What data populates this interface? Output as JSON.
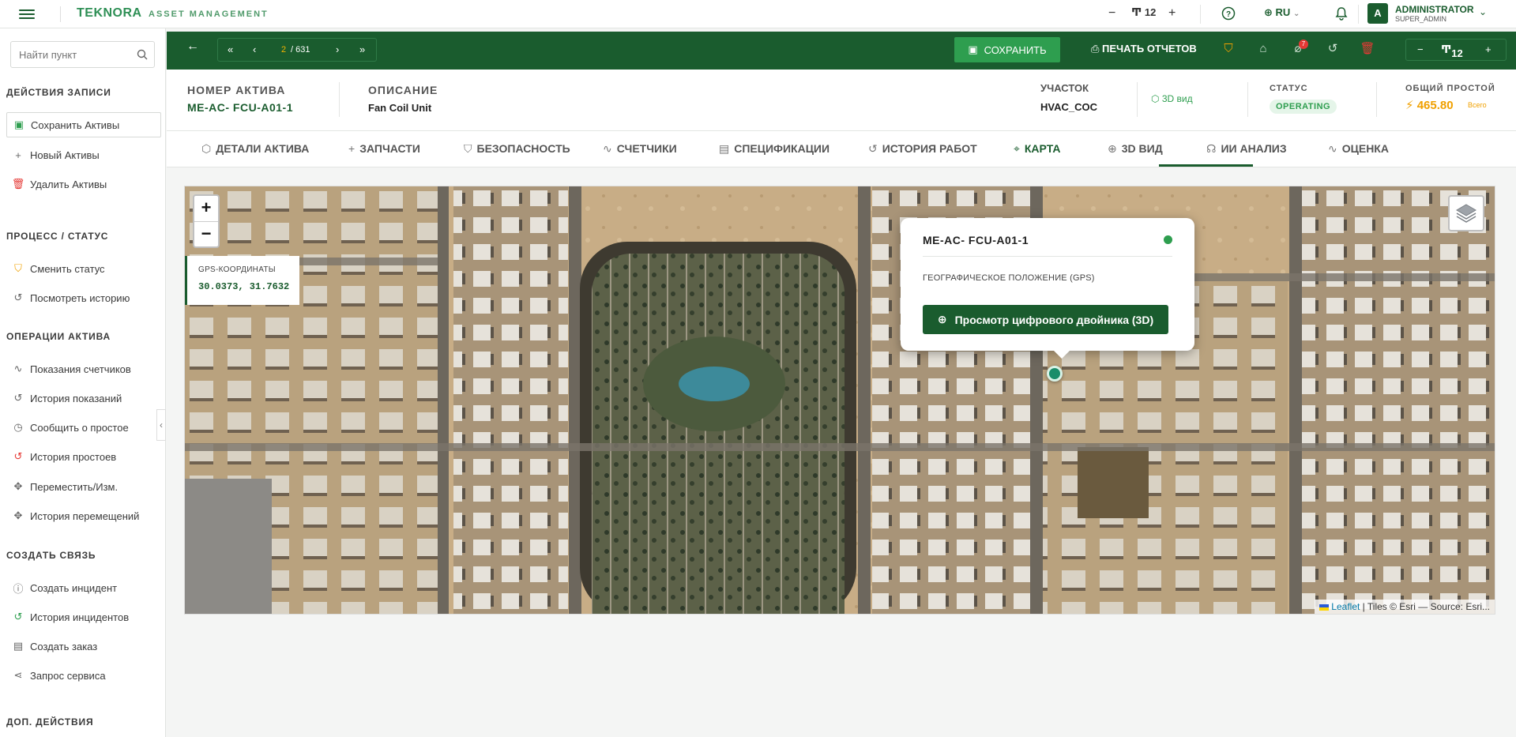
{
  "topbar": {
    "logo": "TEKNORA",
    "subtitle": "ASSET MANAGEMENT",
    "font_size": "12",
    "language": "RU",
    "avatar_letter": "A",
    "user_name": "ADMINISTRATOR",
    "user_role": "SUPER_ADMIN"
  },
  "sidebar": {
    "search_placeholder": "Найти пункт",
    "sections": [
      {
        "title": "ДЕЙСТВИЯ ЗАПИСИ"
      },
      {
        "title": "ПРОЦЕСС / СТАТУС"
      },
      {
        "title": "ОПЕРАЦИИ АКТИВА"
      },
      {
        "title": "СОЗДАТЬ СВЯЗЬ"
      },
      {
        "title": "ДОП. ДЕЙСТВИЯ"
      }
    ],
    "items": [
      {
        "label": "Сохранить Активы",
        "icon": "save-icon"
      },
      {
        "label": "Новый Активы",
        "icon": "plus-icon"
      },
      {
        "label": "Удалить Активы",
        "icon": "trash-icon"
      },
      {
        "label": "Сменить статус",
        "icon": "shield-icon"
      },
      {
        "label": "Посмотреть историю",
        "icon": "history-icon"
      },
      {
        "label": "Показания счетчиков",
        "icon": "activity-icon"
      },
      {
        "label": "История показаний",
        "icon": "history-icon"
      },
      {
        "label": "Сообщить о простое",
        "icon": "clock-icon"
      },
      {
        "label": "История простоев",
        "icon": "history-icon"
      },
      {
        "label": "Переместить/Изм.",
        "icon": "move-icon"
      },
      {
        "label": "История перемещений",
        "icon": "move-icon"
      },
      {
        "label": "Создать инцидент",
        "icon": "alert-icon"
      },
      {
        "label": "История инцидентов",
        "icon": "history-icon"
      },
      {
        "label": "Создать заказ",
        "icon": "document-icon"
      },
      {
        "label": "Запрос сервиса",
        "icon": "share-icon"
      }
    ]
  },
  "actionbar": {
    "page_current": "2",
    "page_total": "/ 631",
    "save_label": "СОХРАНИТЬ",
    "print_label": "ПЕЧАТЬ ОТЧЕТОВ",
    "attachments_badge": "7",
    "font_size": "12"
  },
  "asset": {
    "number_label": "НОМЕР АКТИВА",
    "number_value": "ME-AC- FCU-A01-1",
    "desc_label": "ОПИСАНИЕ",
    "desc_value": "Fan Coil Unit",
    "site_label": "УЧАСТОК",
    "site_value": "HVAC_COC",
    "view3d_label": "3D вид",
    "status_label": "СТАТУС",
    "status_value": "OPERATING",
    "downtime_label": "ОБЩИЙ ПРОСТОЙ",
    "downtime_value": "465.80",
    "downtime_unit": "Всего"
  },
  "tabs": [
    {
      "label": "ДЕТАЛИ АКТИВА",
      "icon": "cube-icon"
    },
    {
      "label": "ЗАПЧАСТИ",
      "icon": "plus-icon"
    },
    {
      "label": "БЕЗОПАСНОСТЬ",
      "icon": "shield-icon"
    },
    {
      "label": "СЧЕТЧИКИ",
      "icon": "activity-icon"
    },
    {
      "label": "СПЕЦИФИКАЦИИ",
      "icon": "document-icon"
    },
    {
      "label": "ИСТОРИЯ РАБОТ",
      "icon": "history-icon"
    },
    {
      "label": "КАРТА",
      "icon": "map-pin-icon",
      "active": true
    },
    {
      "label": "3D ВИД",
      "icon": "globe-icon"
    },
    {
      "label": "ИИ АНАЛИЗ",
      "icon": "brain-icon"
    },
    {
      "label": "ОЦЕНКА",
      "icon": "activity-icon"
    }
  ],
  "map": {
    "zoom_in": "+",
    "zoom_out": "−",
    "gps_label": "GPS-КООРДИНАТЫ",
    "gps_value": "30.0373, 31.7632",
    "popup_title": "ME-AC- FCU-A01-1",
    "popup_geo": "ГЕОГРАФИЧЕСКОЕ ПОЛОЖЕНИЕ (GPS)",
    "twin_button": "Просмотр цифрового двойника (3D)",
    "attribution_link": "Leaflet",
    "attribution_text": " | Tiles © Esri — Source: Esri..."
  },
  "colors": {
    "brand_green": "#1a5c2e",
    "save_green": "#2e9e4f",
    "status_green": "#2e9e4f",
    "downtime_orange": "#f0a000",
    "danger_red": "#e53935"
  }
}
